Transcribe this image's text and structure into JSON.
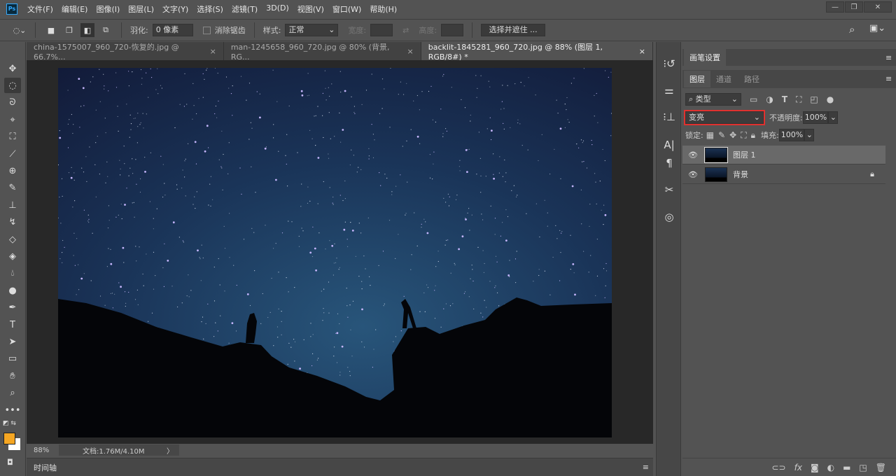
{
  "app": {
    "logo": "Ps"
  },
  "menu": [
    "文件(F)",
    "编辑(E)",
    "图像(I)",
    "图层(L)",
    "文字(Y)",
    "选择(S)",
    "滤镜(T)",
    "3D(D)",
    "视图(V)",
    "窗口(W)",
    "帮助(H)"
  ],
  "window_controls": [
    "—",
    "❐",
    "✕"
  ],
  "options": {
    "feather_label": "羽化:",
    "feather_value": "0 像素",
    "antialias_label": "消除锯齿",
    "style_label": "样式:",
    "style_value": "正常",
    "width_label": "宽度:",
    "height_label": "高度:",
    "select_mask_button": "选择并遮住 ..."
  },
  "tabs": [
    {
      "label": "china-1575007_960_720-恢复的.jpg @ 66.7%...",
      "close": "×",
      "active": false
    },
    {
      "label": "man-1245658_960_720.jpg @ 80% (背景, RG...",
      "close": "×",
      "active": false
    },
    {
      "label": "backlit-1845281_960_720.jpg @ 88% (图层 1, RGB/8#) *",
      "close": "×",
      "active": true
    }
  ],
  "colors": {
    "foreground": "#f5a623",
    "background": "#ffffff",
    "highlight": "#e0312f"
  },
  "status": {
    "zoom": "88%",
    "doc": "文档:1.76M/4.10M",
    "arrow": "〉"
  },
  "timeline": {
    "label": "时间轴"
  },
  "panel": {
    "brush_tab": "画笔设置",
    "tabs": [
      "图层",
      "通道",
      "路径"
    ],
    "filter_kind": "类型",
    "blend_mode": "变亮",
    "opacity_label": "不透明度:",
    "opacity": "100%",
    "lock_label": "锁定:",
    "fill_label": "填充:",
    "fill": "100%",
    "layers": [
      {
        "name": "图层 1",
        "selected": true,
        "locked": false
      },
      {
        "name": "背景",
        "selected": false,
        "locked": true
      }
    ]
  }
}
